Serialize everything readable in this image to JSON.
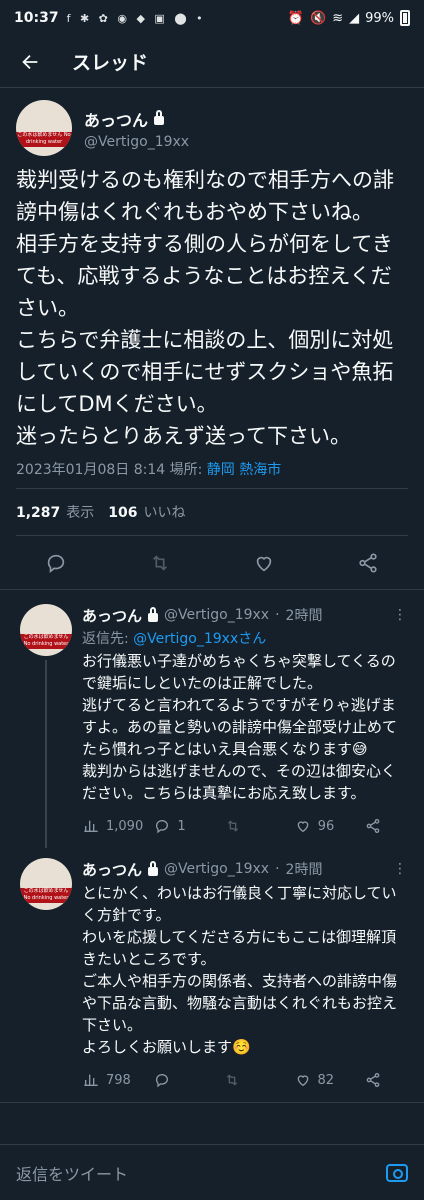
{
  "status": {
    "time": "10:37",
    "notifications": "f ✱ ✿ ◉ ◆ ▣ ⬤ •",
    "battery": "99%"
  },
  "header": {
    "title": "スレッド"
  },
  "main_tweet": {
    "display_name": "あっつん",
    "handle": "@Vertigo_19xx",
    "avatar_text": "この水は飲めません No drinking water",
    "text": "裁判受けるのも権利なので相手方への誹謗中傷はくれぐれもおやめ下さいね。\n相手方を支持する側の人らが何をしてきても、応戦するようなことはお控えください。\nこちらで弁護士に相談の上、個別に対処していくので相手にせずスクショや魚拓にしてDMください。\n迷ったらとりあえず送って下さい。",
    "datetime": "2023年01月08日 8:14",
    "location_label": "場所:",
    "location": "静岡 熱海市",
    "views": "1,287",
    "views_label": "表示",
    "likes": "106",
    "likes_label": "いいね"
  },
  "replies": [
    {
      "display_name": "あっつん",
      "handle": "@Vertigo_19xx",
      "time": "2時間",
      "reply_to_label": "返信先:",
      "reply_to": "@Vertigo_19xxさん",
      "text": "お行儀悪い子達がめちゃくちゃ突撃してくるので鍵垢にしといたのは正解でした。\n逃げてると言われてるようですがそりゃ逃げますよ。あの量と勢いの誹謗中傷全部受け止めてたら慣れっ子とはいえ具合悪くなります",
      "emoji": "😅",
      "text2": "\n裁判からは逃げませんので、その辺は御安心ください。こちらは真摯にお応え致します。",
      "views": "1,090",
      "replies": "1",
      "retweets": "",
      "likes": "96"
    },
    {
      "display_name": "あっつん",
      "handle": "@Vertigo_19xx",
      "time": "2時間",
      "text": "とにかく、わいはお行儀良く丁寧に対応していく方針です。\nわいを応援してくださる方にもここは御理解頂きたいところです。\nご本人や相手方の関係者、支持者への誹謗中傷や下品な言動、物騒な言動はくれぐれもお控え下さい。\nよろしくお願いします",
      "emoji": "☺️",
      "views": "798",
      "likes": "82"
    }
  ],
  "composer": {
    "placeholder": "返信をツイート"
  }
}
